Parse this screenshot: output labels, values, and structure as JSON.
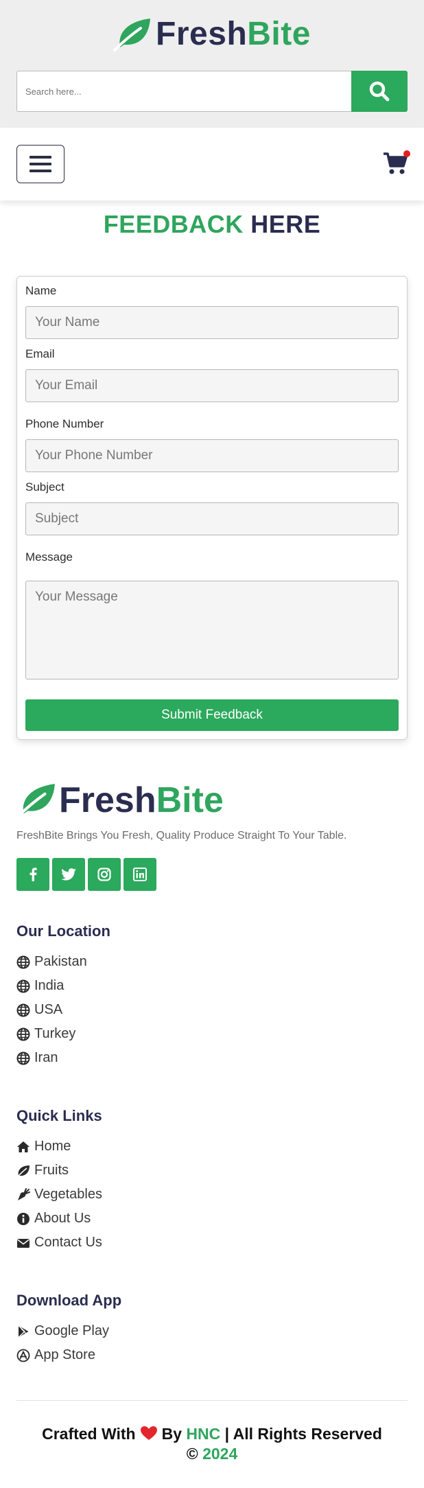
{
  "brand": {
    "part1": "Fresh",
    "part2": "Bite"
  },
  "search": {
    "placeholder": "Search here..."
  },
  "feedback": {
    "title_part1": "FEEDBACK",
    "title_part2": "HERE",
    "fields": [
      {
        "label": "Name",
        "placeholder": "Your Name"
      },
      {
        "label": "Email",
        "placeholder": "Your Email"
      },
      {
        "label": "Phone Number",
        "placeholder": "Your Phone Number"
      },
      {
        "label": "Subject",
        "placeholder": "Subject"
      },
      {
        "label": "Message",
        "placeholder": "Your Message"
      }
    ],
    "submit_label": "Submit Feedback"
  },
  "footer": {
    "tagline": "FreshBite Brings You Fresh, Quality Produce Straight To Your Table.",
    "location": {
      "heading": "Our Location",
      "items": [
        "Pakistan",
        "India",
        "USA",
        "Turkey",
        "Iran"
      ]
    },
    "quick_links": {
      "heading": "Quick Links",
      "items": [
        {
          "label": "Home",
          "icon": "home-icon"
        },
        {
          "label": "Fruits",
          "icon": "leaf-icon"
        },
        {
          "label": "Vegetables",
          "icon": "carrot-icon"
        },
        {
          "label": "About Us",
          "icon": "info-icon"
        },
        {
          "label": "Contact Us",
          "icon": "envelope-icon"
        }
      ]
    },
    "download": {
      "heading": "Download App",
      "items": [
        {
          "label": "Google Play",
          "icon": "google-play-icon"
        },
        {
          "label": "App Store",
          "icon": "app-store-icon"
        }
      ]
    },
    "credit": {
      "crafted": "Crafted With",
      "by": "By",
      "author": "HNC",
      "rights": "| All Rights Reserved",
      "copyright": "©",
      "year": "2024"
    }
  },
  "colors": {
    "green": "#2ba95c",
    "navy": "#2a2d4f",
    "header_bg": "#eeeeee",
    "cart_badge": "#e21f1f"
  }
}
